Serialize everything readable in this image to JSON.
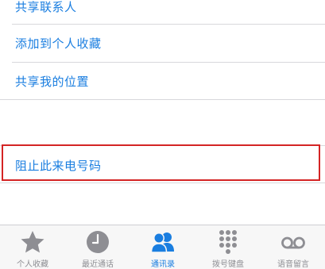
{
  "menu": {
    "items": [
      {
        "label": "共享联系人"
      },
      {
        "label": "添加到个人收藏"
      },
      {
        "label": "共享我的位置"
      }
    ],
    "block_label": "阻止此来电号码"
  },
  "colors": {
    "accent": "#1a7ee0",
    "inactive": "#8e8e93",
    "highlight_border": "#d42424"
  },
  "tabbar": {
    "tabs": [
      {
        "label": "个人收藏",
        "icon": "star-icon",
        "active": false
      },
      {
        "label": "最近通话",
        "icon": "clock-icon",
        "active": false
      },
      {
        "label": "通讯录",
        "icon": "contacts-icon",
        "active": true
      },
      {
        "label": "拨号键盘",
        "icon": "keypad-icon",
        "active": false
      },
      {
        "label": "语音留言",
        "icon": "voicemail-icon",
        "active": false
      }
    ]
  }
}
